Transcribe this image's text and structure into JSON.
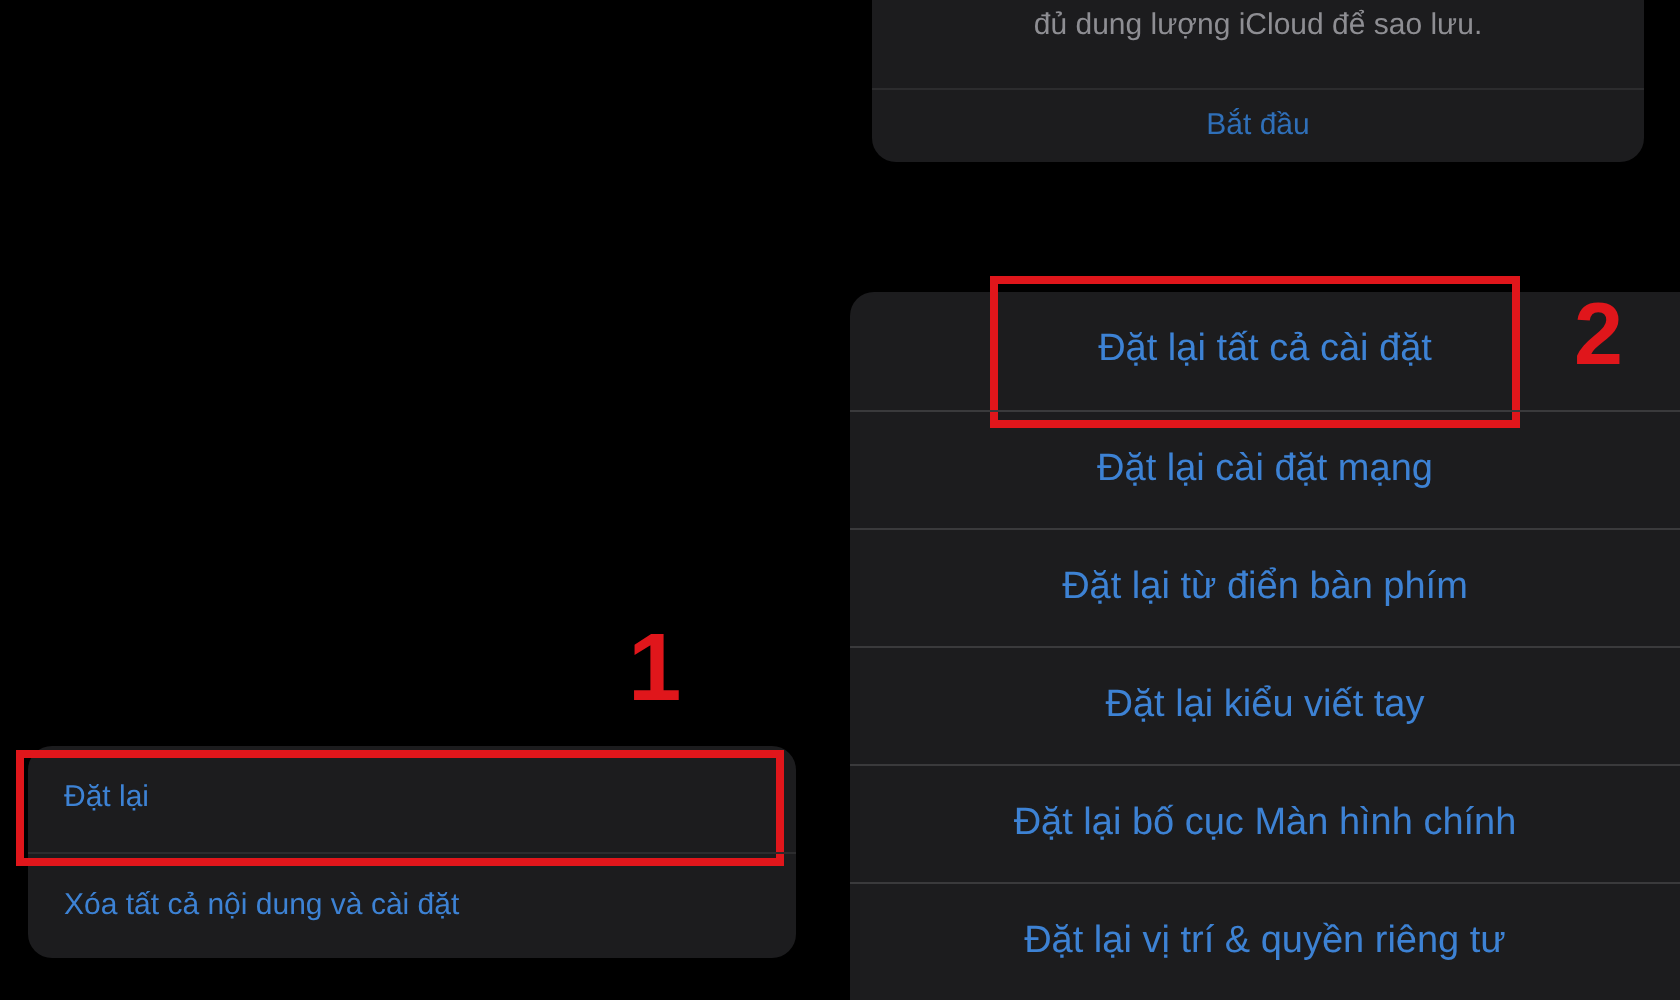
{
  "backup_card": {
    "message": "đủ dung lượng iCloud để sao lưu.",
    "action": "Bắt đầu"
  },
  "reset_menu": {
    "items": [
      {
        "label": "Đặt lại",
        "highlighted": true,
        "step": "1"
      },
      {
        "label": "Xóa tất cả nội dung và cài đặt",
        "highlighted": false
      }
    ]
  },
  "reset_options": {
    "items": [
      {
        "label": "Đặt lại tất cả cài đặt",
        "highlighted": true,
        "step": "2"
      },
      {
        "label": "Đặt lại cài đặt mạng",
        "highlighted": false
      },
      {
        "label": "Đặt lại từ điển bàn phím",
        "highlighted": false
      },
      {
        "label": "Đặt lại kiểu viết tay",
        "highlighted": false
      },
      {
        "label": "Đặt lại bố cục Màn hình chính",
        "highlighted": false
      },
      {
        "label": "Đặt lại vị trí & quyền riêng tư",
        "highlighted": false
      }
    ]
  }
}
